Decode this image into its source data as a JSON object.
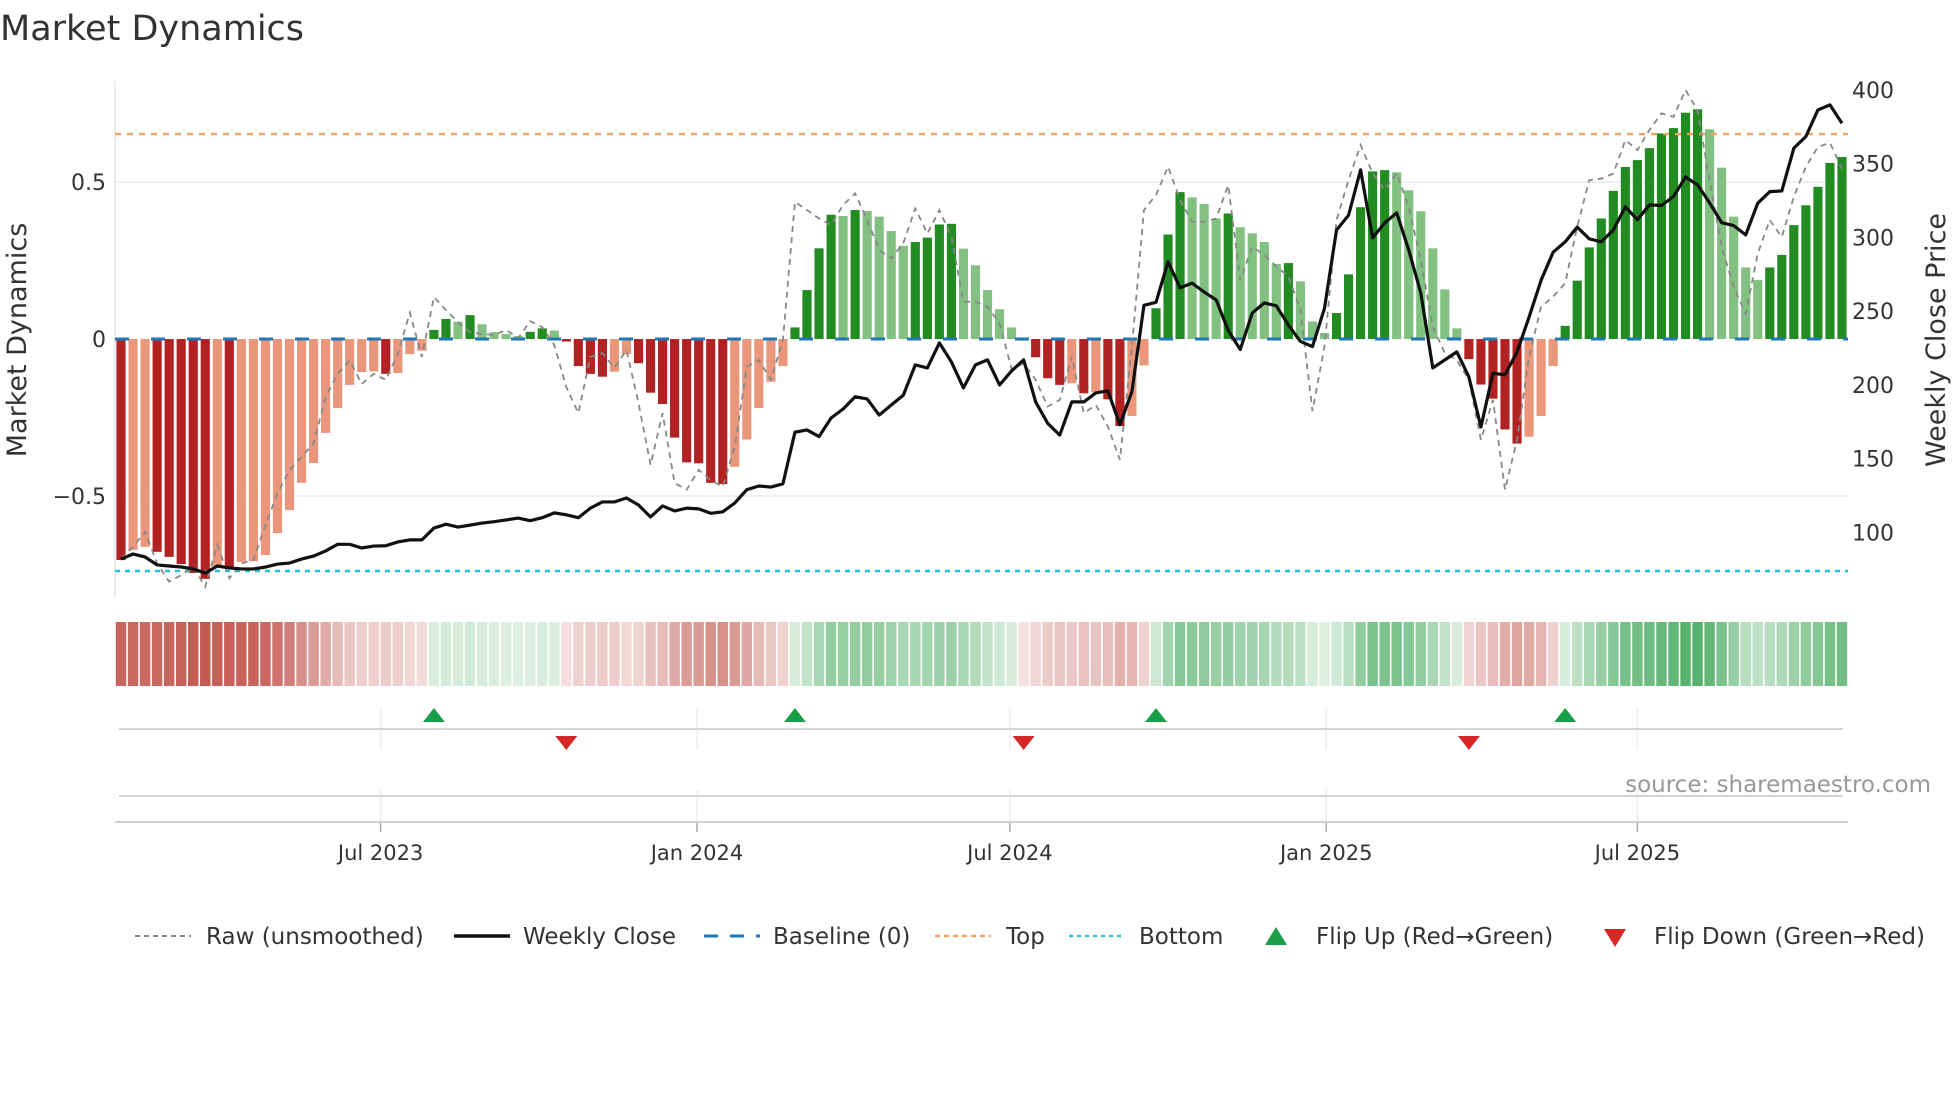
{
  "chart_data": {
    "type": "bar",
    "title": "Market Dynamics",
    "ylabel": "Market Dynamics",
    "y2label": "Weekly Close Price",
    "ylim": [
      -0.825,
      0.822
    ],
    "y2lim": [
      55.6,
      406
    ],
    "yticks": [
      {
        "v": 0.5,
        "label": "0.5"
      },
      {
        "v": 0,
        "label": "0"
      },
      {
        "v": -0.5,
        "label": "−0.5"
      }
    ],
    "y2ticks": [
      {
        "v": 400,
        "label": "400"
      },
      {
        "v": 350,
        "label": "350"
      },
      {
        "v": 300,
        "label": "300"
      },
      {
        "v": 250,
        "label": "250"
      },
      {
        "v": 200,
        "label": "200"
      },
      {
        "v": 150,
        "label": "150"
      },
      {
        "v": 100,
        "label": "100"
      }
    ],
    "x_start": "2023-01-31",
    "x_step_days": 7,
    "xticks": [
      {
        "date": "2023-07-01",
        "label": "Jul 2023"
      },
      {
        "date": "2024-01-01",
        "label": "Jan 2024"
      },
      {
        "date": "2024-07-01",
        "label": "Jul 2024"
      },
      {
        "date": "2025-01-01",
        "label": "Jan 2025"
      },
      {
        "date": "2025-07-01",
        "label": "Jul 2025"
      }
    ],
    "baseline": 0,
    "top": 0.653,
    "bottom": -0.739,
    "grid": true,
    "legend_position": "bottom",
    "source": "source: sharemaestro.com",
    "colors": {
      "red_strong": "#b22222",
      "red_weak": "#e9967a",
      "green_strong": "#228b22",
      "green_weak": "#82c182",
      "strip_red": "#b8392f",
      "strip_green": "#2f9f4a",
      "raw": "#888888",
      "close": "#111111",
      "baseline": "#1f77b4",
      "top": "#f0a35e",
      "bottom": "#22c3d6",
      "flip_up": "#1a9e48",
      "flip_down": "#d62728"
    },
    "series": [
      {
        "name": "Market Dynamics (smoothed)",
        "axis": "left",
        "kind": "bar",
        "values": [
          -0.704,
          -0.672,
          -0.662,
          -0.678,
          -0.694,
          -0.717,
          -0.745,
          -0.764,
          -0.726,
          -0.726,
          -0.71,
          -0.708,
          -0.688,
          -0.618,
          -0.545,
          -0.458,
          -0.395,
          -0.299,
          -0.22,
          -0.146,
          -0.105,
          -0.103,
          -0.111,
          -0.108,
          -0.048,
          -0.037,
          0.029,
          0.064,
          0.055,
          0.076,
          0.047,
          0.022,
          0.016,
          0.01,
          0.023,
          0.034,
          0.027,
          -0.008,
          -0.086,
          -0.111,
          -0.12,
          -0.104,
          -0.048,
          -0.077,
          -0.171,
          -0.207,
          -0.314,
          -0.393,
          -0.396,
          -0.458,
          -0.462,
          -0.407,
          -0.32,
          -0.22,
          -0.136,
          -0.086,
          0.037,
          0.156,
          0.289,
          0.396,
          0.392,
          0.411,
          0.408,
          0.39,
          0.344,
          0.297,
          0.309,
          0.323,
          0.365,
          0.367,
          0.288,
          0.235,
          0.156,
          0.095,
          0.037,
          -0.005,
          -0.058,
          -0.125,
          -0.146,
          -0.141,
          -0.173,
          -0.17,
          -0.192,
          -0.277,
          -0.245,
          -0.084,
          0.098,
          0.333,
          0.468,
          0.451,
          0.43,
          0.384,
          0.4,
          0.356,
          0.337,
          0.309,
          0.239,
          0.242,
          0.184,
          0.056,
          0.019,
          0.083,
          0.206,
          0.42,
          0.534,
          0.538,
          0.531,
          0.474,
          0.407,
          0.289,
          0.158,
          0.034,
          -0.064,
          -0.145,
          -0.19,
          -0.288,
          -0.333,
          -0.311,
          -0.245,
          -0.086,
          0.042,
          0.186,
          0.292,
          0.384,
          0.472,
          0.548,
          0.57,
          0.608,
          0.655,
          0.672,
          0.721,
          0.732,
          0.668,
          0.546,
          0.39,
          0.228,
          0.188,
          0.228,
          0.268,
          0.363,
          0.426,
          0.485,
          0.561,
          0.58
        ]
      },
      {
        "name": "Raw (unsmoothed)",
        "axis": "left",
        "kind": "line",
        "values": [
          -0.7,
          -0.662,
          -0.614,
          -0.715,
          -0.773,
          -0.752,
          -0.725,
          -0.789,
          -0.656,
          -0.762,
          -0.715,
          -0.704,
          -0.593,
          -0.492,
          -0.418,
          -0.375,
          -0.333,
          -0.185,
          -0.111,
          -0.068,
          -0.143,
          -0.111,
          -0.13,
          -0.047,
          0.084,
          -0.057,
          0.134,
          0.092,
          0.054,
          0.022,
          0.016,
          0.013,
          0.029,
          0.003,
          0.057,
          0.038,
          -0.019,
          -0.153,
          -0.236,
          -0.057,
          -0.045,
          -0.092,
          -0.035,
          -0.204,
          -0.401,
          -0.236,
          -0.459,
          -0.48,
          -0.417,
          -0.45,
          -0.47,
          -0.343,
          -0.088,
          -0.067,
          -0.13,
          -0.003,
          0.437,
          0.411,
          0.384,
          0.363,
          0.427,
          0.464,
          0.379,
          0.284,
          0.257,
          0.305,
          0.416,
          0.336,
          0.411,
          0.326,
          0.119,
          0.119,
          0.103,
          0.05,
          -0.095,
          -0.078,
          -0.13,
          -0.215,
          -0.194,
          -0.056,
          -0.236,
          -0.21,
          -0.279,
          -0.385,
          -0.024,
          0.411,
          0.459,
          0.549,
          0.443,
          0.374,
          0.374,
          0.384,
          0.49,
          0.188,
          0.294,
          0.268,
          0.231,
          0.199,
          0.093,
          -0.23,
          -0.024,
          0.379,
          0.507,
          0.618,
          0.528,
          0.475,
          0.528,
          0.421,
          0.252,
          0.04,
          -0.045,
          -0.067,
          -0.13,
          -0.321,
          -0.194,
          -0.48,
          -0.321,
          -0.056,
          0.103,
          0.135,
          0.178,
          0.358,
          0.506,
          0.511,
          0.527,
          0.634,
          0.602,
          0.666,
          0.719,
          0.708,
          0.793,
          0.729,
          0.506,
          0.294,
          0.166,
          0.081,
          0.272,
          0.379,
          0.325,
          0.453,
          0.549,
          0.612,
          0.625,
          0.543
        ]
      },
      {
        "name": "Weekly Close",
        "axis": "right",
        "kind": "line",
        "values": [
          82,
          85.4,
          83.4,
          78,
          77.3,
          76.6,
          75.3,
          72.5,
          77.3,
          76,
          75.3,
          75.3,
          76.6,
          78.6,
          79.3,
          82,
          84,
          87.5,
          92,
          92,
          89.5,
          90.8,
          91,
          93.6,
          95,
          95,
          103,
          105.6,
          103.7,
          105,
          106.4,
          107.3,
          108.5,
          109.8,
          108,
          110,
          113.3,
          112,
          110,
          116.5,
          120.7,
          120.7,
          123.4,
          118.6,
          110.5,
          118,
          114.6,
          116.5,
          116,
          113,
          114,
          120,
          129,
          131.5,
          130.8,
          133,
          168,
          169.5,
          165,
          177.6,
          183.7,
          192,
          190.5,
          179.6,
          186.4,
          193,
          213.6,
          211.5,
          228.5,
          215.6,
          198,
          213.6,
          217,
          200,
          209.5,
          217,
          188.5,
          174,
          166,
          188.5,
          188.5,
          194.6,
          196,
          173,
          195.5,
          254,
          256,
          283.5,
          265.8,
          269,
          263,
          257.6,
          237,
          224,
          248.8,
          255.6,
          253.6,
          240.6,
          229.5,
          226,
          252,
          305,
          315,
          345.8,
          299.7,
          309.8,
          316.6,
          291.5,
          262.4,
          211.5,
          217,
          222.4,
          205.4,
          171.5,
          208,
          206.8,
          222.4,
          246,
          271,
          290,
          297,
          307,
          299,
          297,
          305,
          320.7,
          312,
          322,
          321.6,
          327.7,
          341,
          335.6,
          323.4,
          310,
          308,
          301.7,
          323.2,
          331,
          331.5,
          360.5,
          368.4,
          386.4,
          389.8,
          377.4
        ]
      }
    ],
    "flips_up": [
      26,
      56,
      86,
      120
    ],
    "flips_down": [
      37,
      75,
      112
    ],
    "legend": [
      {
        "key": "raw",
        "label": "Raw (unsmoothed)"
      },
      {
        "key": "close",
        "label": "Weekly Close"
      },
      {
        "key": "baseline",
        "label": "Baseline (0)"
      },
      {
        "key": "top",
        "label": "Top"
      },
      {
        "key": "bottom",
        "label": "Bottom"
      },
      {
        "key": "flip_up",
        "label": "Flip Up (Red→Green)"
      },
      {
        "key": "flip_down",
        "label": "Flip Down (Green→Red)"
      }
    ]
  }
}
